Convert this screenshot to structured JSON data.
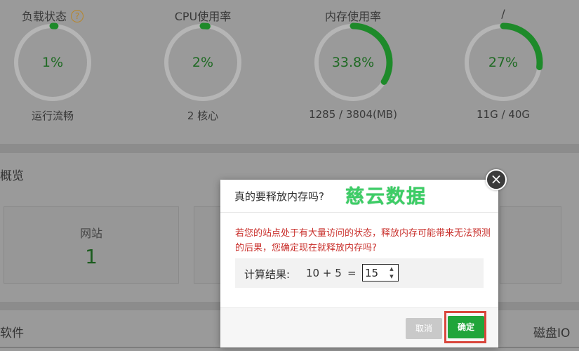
{
  "dashboard": {
    "gauges": [
      {
        "title": "负载状态",
        "value": "1%",
        "percent": 1,
        "subtitle": "运行流畅",
        "help_icon": "?"
      },
      {
        "title": "CPU使用率",
        "value": "2%",
        "percent": 2,
        "subtitle": "2 核心"
      },
      {
        "title": "内存使用率",
        "value": "33.8%",
        "percent": 33.8,
        "subtitle": "1285 / 3804(MB)"
      },
      {
        "title": "/",
        "value": "27%",
        "percent": 27,
        "subtitle": "11G / 40G"
      }
    ],
    "overview_title": "概览",
    "site_card": {
      "label": "网站",
      "value": "1"
    },
    "software_title": "软件",
    "disk_io_title": "磁盘IO"
  },
  "dialog": {
    "title": "真的要释放内存吗?",
    "watermark": "慈云数据",
    "close_icon": "×",
    "warning": "若您的站点处于有大量访问的状态，释放内存可能带来无法预测的后果，您确定现在就释放内存吗?",
    "calc_label": "计算结果:",
    "calc_expression": "10 + 5",
    "calc_equals": "=",
    "calc_answer": "15",
    "cancel_label": "取消",
    "confirm_label": "确定"
  },
  "colors": {
    "gauge_progress": "#1e8a2a",
    "gauge_track": "#b5b5b5",
    "warning_text": "#c9302c",
    "confirm_button": "#20a53a",
    "highlight_frame": "#d9463c",
    "watermark": "#3dcd66"
  }
}
